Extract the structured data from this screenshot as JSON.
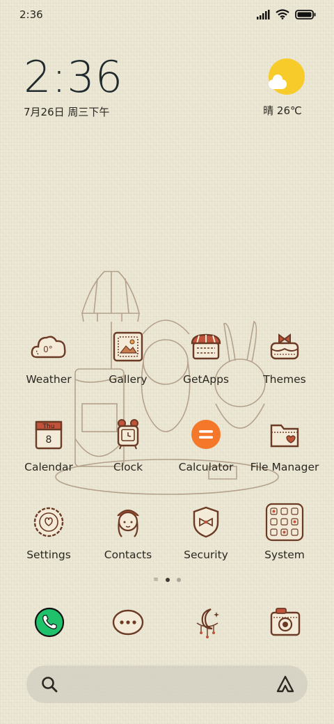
{
  "status_bar": {
    "time": "2:36"
  },
  "clock_widget": {
    "time": "2:36",
    "date": "7月26日 周三下午"
  },
  "weather_widget": {
    "text": "晴 26℃",
    "sun_color": "#f7cb2a"
  },
  "apps": [
    {
      "label": "Weather",
      "icon": "weather-cloud-icon",
      "badge": "0°"
    },
    {
      "label": "Gallery",
      "icon": "gallery-frame-icon"
    },
    {
      "label": "GetApps",
      "icon": "shop-basket-icon"
    },
    {
      "label": "Themes",
      "icon": "cake-bow-icon"
    },
    {
      "label": "Calendar",
      "icon": "calendar-icon",
      "calendar_day": "Thu",
      "calendar_date": "8"
    },
    {
      "label": "Clock",
      "icon": "alarm-clock-icon"
    },
    {
      "label": "Calculator",
      "icon": "calculator-icon",
      "accent": "#f5782a"
    },
    {
      "label": "File Manager",
      "icon": "folder-icon"
    },
    {
      "label": "Settings",
      "icon": "gear-donut-icon"
    },
    {
      "label": "Contacts",
      "icon": "girl-avatar-icon"
    },
    {
      "label": "Security",
      "icon": "shield-bow-icon"
    },
    {
      "label": "System",
      "icon": "system-grid-icon"
    }
  ],
  "dock": [
    {
      "icon": "phone-icon",
      "accent": "#1fc26b"
    },
    {
      "icon": "messages-bubble-icon"
    },
    {
      "icon": "moon-charm-icon"
    },
    {
      "icon": "camera-icon"
    }
  ],
  "colors": {
    "background": "#ebe7d4",
    "line": "#6b3a24"
  }
}
